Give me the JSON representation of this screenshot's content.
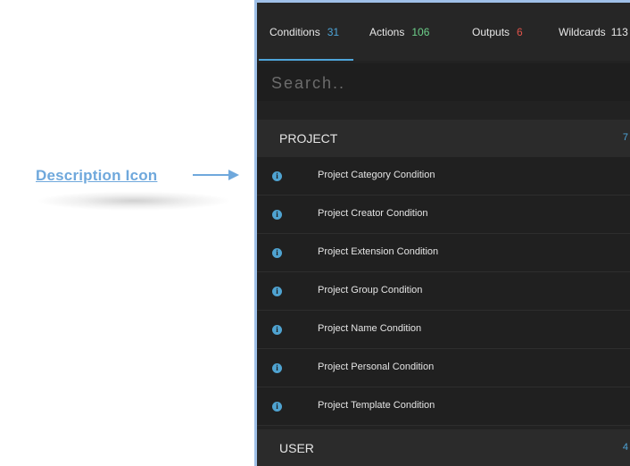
{
  "annotation": {
    "label": "Description Icon"
  },
  "tabs": [
    {
      "label": "Conditions",
      "count": "31",
      "count_color": "#4ea5d9",
      "active": true
    },
    {
      "label": "Actions",
      "count": "106",
      "count_color": "#6dd08a"
    },
    {
      "label": "Outputs",
      "count": "6",
      "count_color": "#e0534a"
    },
    {
      "label": "Wildcards",
      "count": "113",
      "count_color": "#e8e8e8"
    }
  ],
  "search": {
    "placeholder": "Search.."
  },
  "sections": [
    {
      "title": "PROJECT",
      "count": "7",
      "items": [
        "Project Category Condition",
        "Project Creator Condition",
        "Project Extension Condition",
        "Project Group Condition",
        "Project Name Condition",
        "Project Personal Condition",
        "Project Template Condition"
      ]
    },
    {
      "title": "USER",
      "count": "4",
      "items": []
    }
  ],
  "icons": {
    "row_icon": "info-icon",
    "arrow": "arrow-right-icon"
  },
  "colors": {
    "accent": "#4ea5d9",
    "annotation": "#6fa8dc",
    "panel": "#222222"
  }
}
